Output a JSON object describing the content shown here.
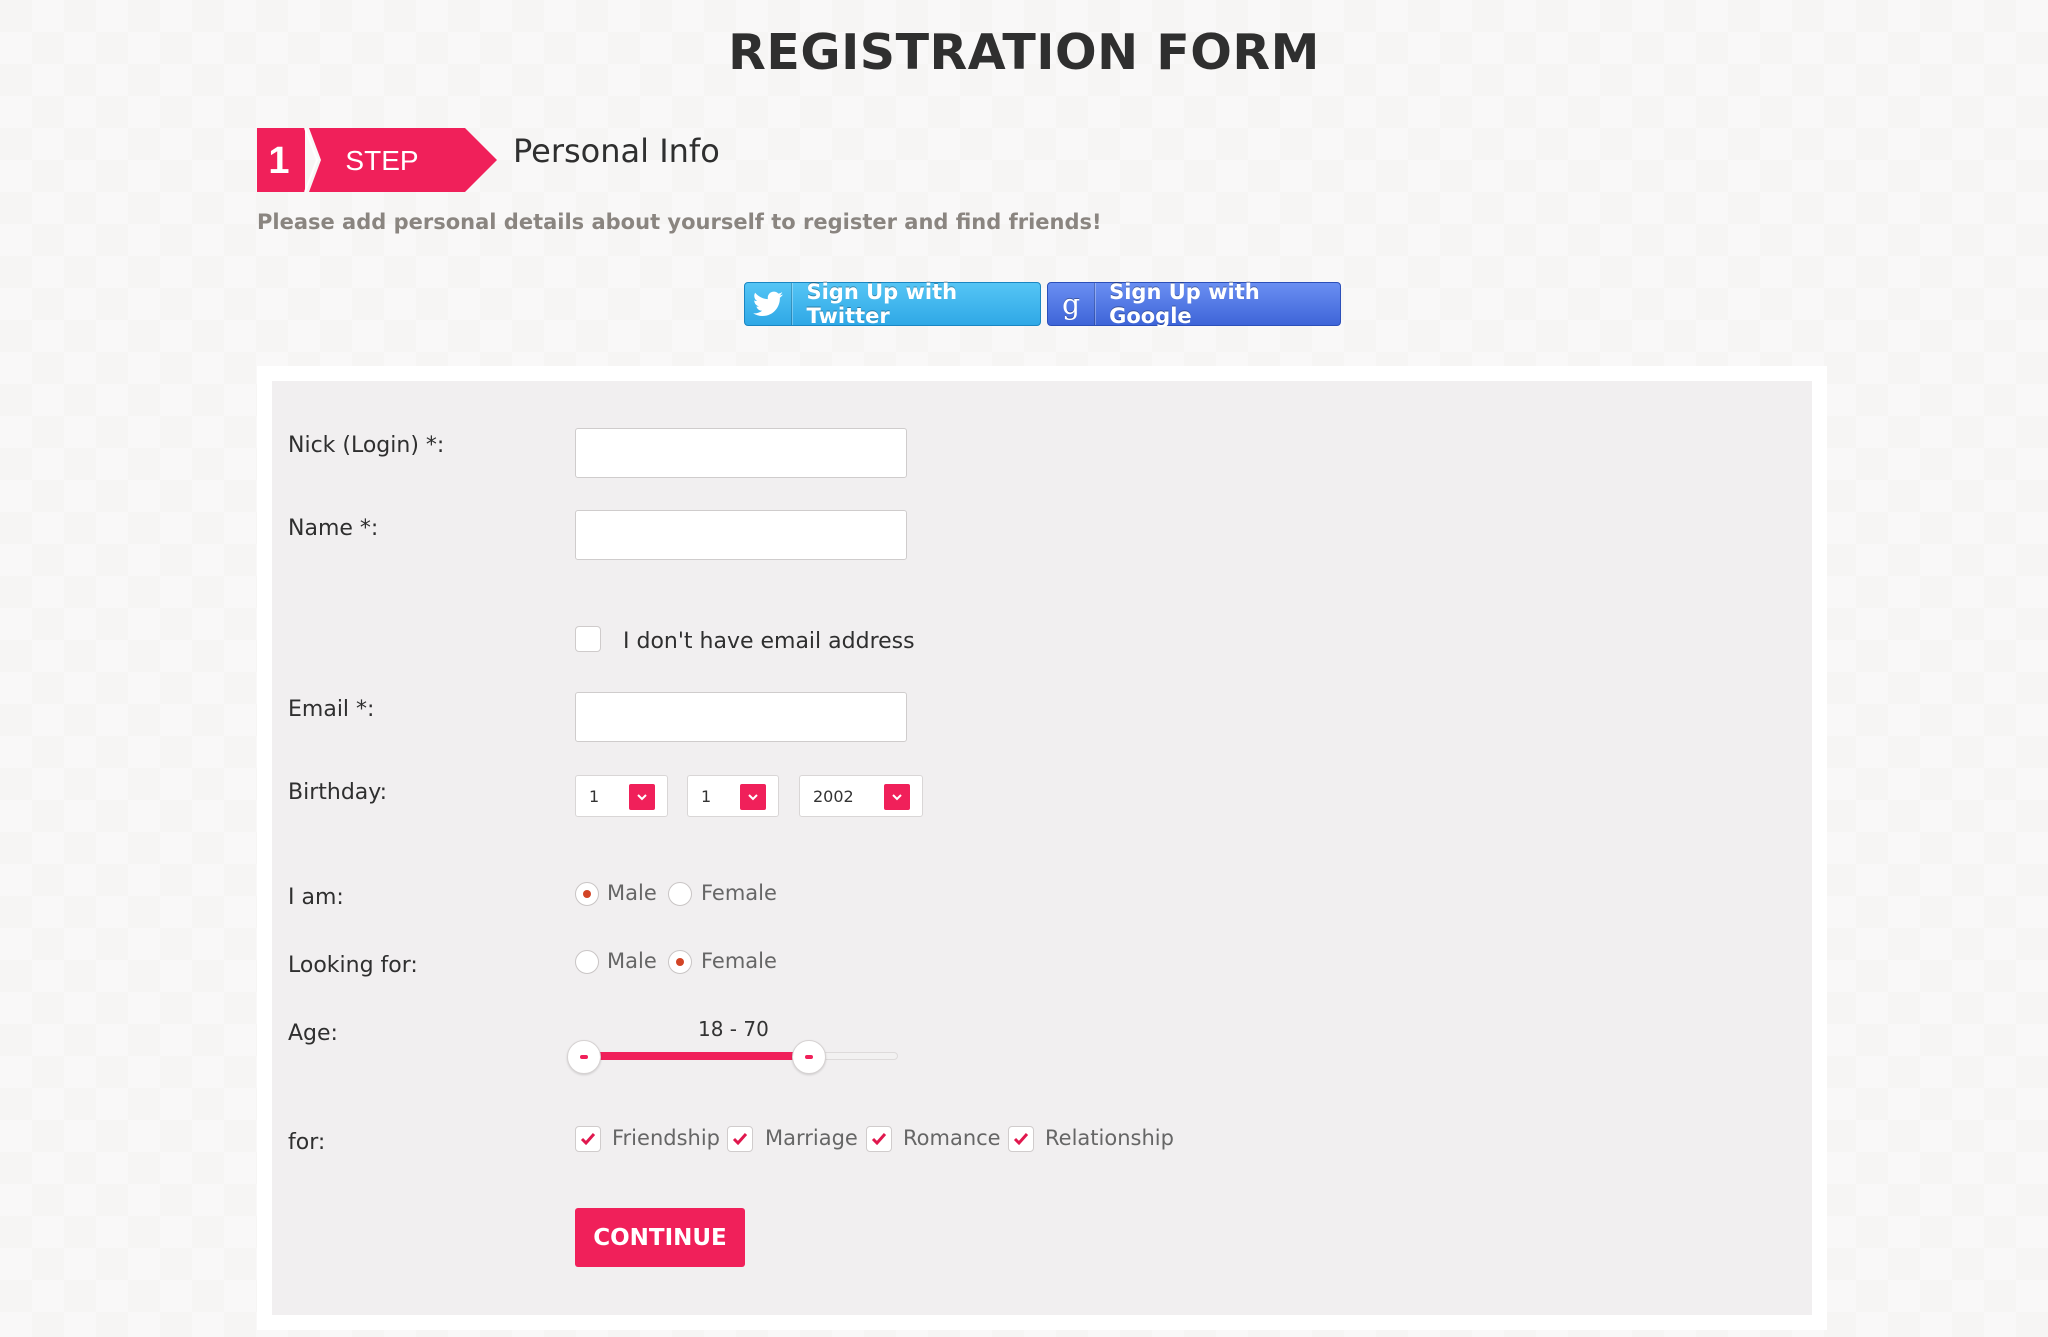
{
  "page": {
    "title": "REGISTRATION FORM"
  },
  "step": {
    "number": "1",
    "label": "STEP",
    "title": "Personal Info",
    "subtitle": "Please add personal details about yourself to register and find friends!"
  },
  "social": {
    "twitter_label": "Sign Up with Twitter",
    "google_label": "Sign Up with Google",
    "google_glyph": "g"
  },
  "form": {
    "nick": {
      "label": "Nick (Login) *:",
      "value": ""
    },
    "name": {
      "label": "Name *:",
      "value": ""
    },
    "no_email": {
      "label": "I don't have email address",
      "checked": false
    },
    "email": {
      "label": "Email *:",
      "value": ""
    },
    "birthday": {
      "label": "Birthday:",
      "day": "1",
      "month": "1",
      "year": "2002"
    },
    "gender": {
      "label": "I am:",
      "options": [
        "Male",
        "Female"
      ],
      "selected": "Male"
    },
    "looking_for": {
      "label": "Looking for:",
      "options": [
        "Male",
        "Female"
      ],
      "selected": "Female"
    },
    "age": {
      "label": "Age:",
      "range_text": "18 - 70",
      "min": 18,
      "max": 70
    },
    "purpose": {
      "label": "for:",
      "options": [
        {
          "label": "Friendship",
          "checked": true
        },
        {
          "label": "Marriage",
          "checked": true
        },
        {
          "label": "Romance",
          "checked": true
        },
        {
          "label": "Relationship",
          "checked": true
        }
      ]
    },
    "continue_label": "CONTINUE"
  },
  "colors": {
    "accent": "#f0205a",
    "twitter": "#2fa8e6",
    "google": "#3e65d8",
    "radio_dot": "#d24426"
  }
}
